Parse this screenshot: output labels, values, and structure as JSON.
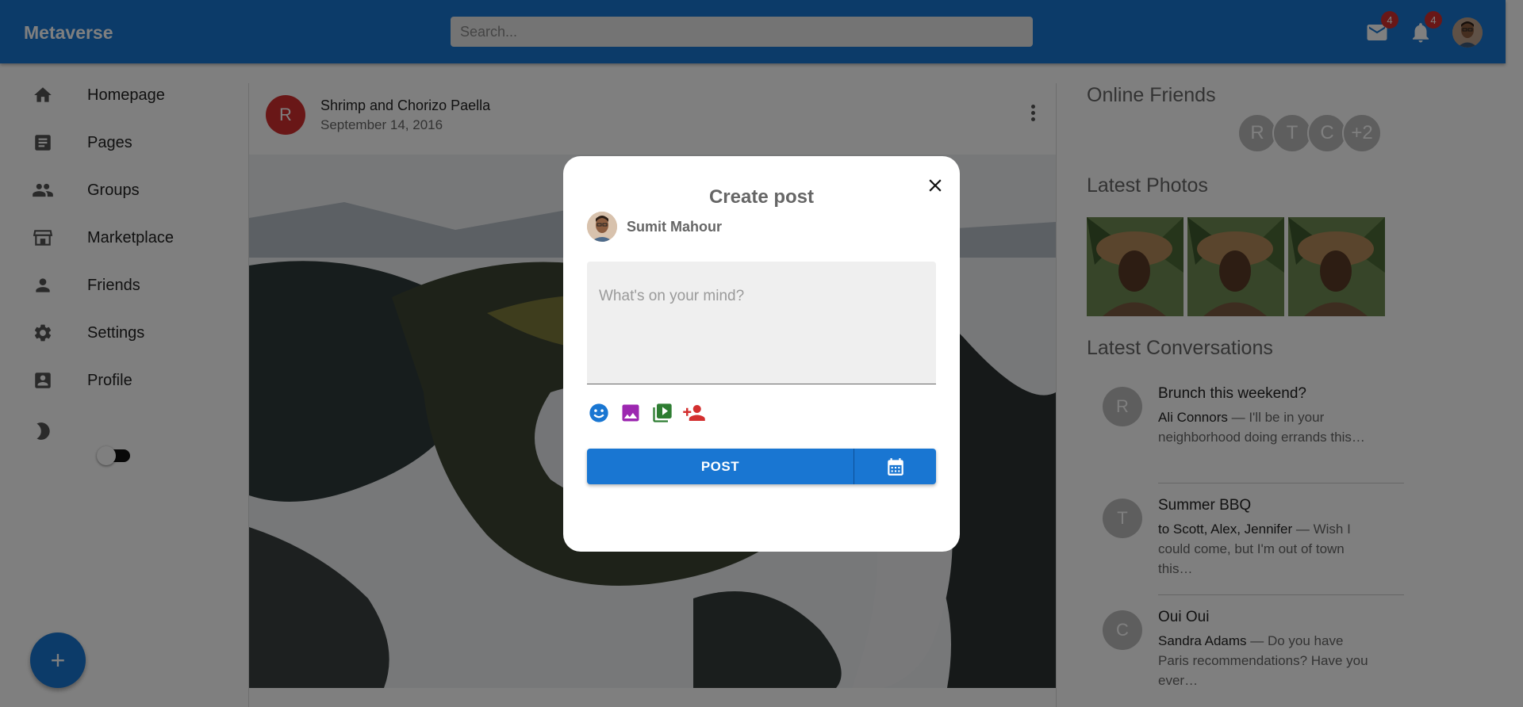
{
  "app": {
    "brand": "Metaverse"
  },
  "search": {
    "placeholder": "Search..."
  },
  "topbar": {
    "mail_badge": "4",
    "notif_badge": "4"
  },
  "sidebar": {
    "items": [
      {
        "label": "Homepage",
        "icon": "home-icon"
      },
      {
        "label": "Pages",
        "icon": "article-icon"
      },
      {
        "label": "Groups",
        "icon": "group-icon"
      },
      {
        "label": "Marketplace",
        "icon": "storefront-icon"
      },
      {
        "label": "Friends",
        "icon": "person-icon"
      },
      {
        "label": "Settings",
        "icon": "gear-icon"
      },
      {
        "label": "Profile",
        "icon": "account-box-icon"
      }
    ],
    "dark_mode_on": false,
    "fab_label": "+"
  },
  "post": {
    "avatar_letter": "R",
    "title": "Shrimp and Chorizo Paella",
    "date": "September 14, 2016"
  },
  "right": {
    "online_title": "Online Friends",
    "online": [
      "R",
      "T",
      "C",
      "+2"
    ],
    "photos_title": "Latest Photos",
    "conversations_title": "Latest Conversations",
    "conversations": [
      {
        "letter": "R",
        "title": "Brunch this weekend?",
        "who": "Ali Connors",
        "text": " — I'll be in your neighborhood doing errands this…"
      },
      {
        "letter": "T",
        "title": "Summer BBQ",
        "who": "to Scott, Alex, Jennifer",
        "text": " — Wish I could come, but I'm out of town this…"
      },
      {
        "letter": "C",
        "title": "Oui Oui",
        "who": "Sandra Adams",
        "text": " — Do you have Paris recommendations? Have you ever…"
      }
    ]
  },
  "modal": {
    "title": "Create post",
    "user": "Sumit Mahour",
    "placeholder": "What's on your mind?",
    "tools": [
      "emoji-icon",
      "image-icon",
      "video-icon",
      "tag-person-icon"
    ],
    "post_label": "POST",
    "schedule_icon": "calendar-icon",
    "colors": {
      "primary": "#1976d2",
      "emoji": "#1976d2",
      "image": "#9c27b0",
      "video": "#2e7d32",
      "tag": "#d32f2f"
    }
  }
}
